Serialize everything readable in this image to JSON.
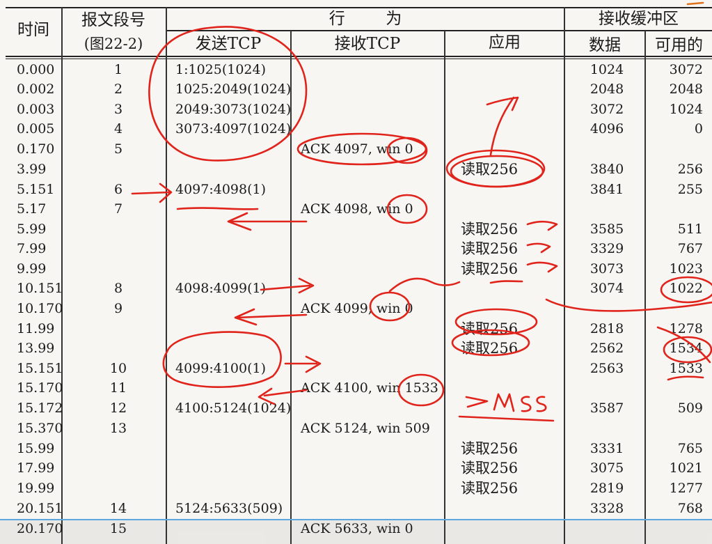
{
  "headers": {
    "time": "时间",
    "segment": "报文段号",
    "segment_sub": "(图22-2)",
    "behavior": "行        为",
    "send_tcp": "发送TCP",
    "recv_tcp": "接收TCP",
    "app": "应用",
    "recv_buffer": "接收缓冲区",
    "data": "数据",
    "available": "可用的"
  },
  "rows": [
    {
      "time": "0.000",
      "seg": "1",
      "send": "1:1025(1024)",
      "recv": "",
      "app": "",
      "data": "1024",
      "avail": "3072"
    },
    {
      "time": "0.002",
      "seg": "2",
      "send": "1025:2049(1024)",
      "recv": "",
      "app": "",
      "data": "2048",
      "avail": "2048"
    },
    {
      "time": "0.003",
      "seg": "3",
      "send": "2049:3073(1024)",
      "recv": "",
      "app": "",
      "data": "3072",
      "avail": "1024"
    },
    {
      "time": "0.005",
      "seg": "4",
      "send": "3073:4097(1024)",
      "recv": "",
      "app": "",
      "data": "4096",
      "avail": "0"
    },
    {
      "time": "0.170",
      "seg": "5",
      "send": "",
      "recv": "ACK 4097, win 0",
      "app": "",
      "data": "",
      "avail": ""
    },
    {
      "time": "3.99",
      "seg": "",
      "send": "",
      "recv": "",
      "app": "读取256",
      "data": "3840",
      "avail": "256"
    },
    {
      "time": "5.151",
      "seg": "6",
      "send": "4097:4098(1)",
      "recv": "",
      "app": "",
      "data": "3841",
      "avail": "255"
    },
    {
      "time": "5.17",
      "seg": "7",
      "send": "",
      "recv": "ACK 4098, win 0",
      "app": "",
      "data": "",
      "avail": ""
    },
    {
      "time": "5.99",
      "seg": "",
      "send": "",
      "recv": "",
      "app": "读取256",
      "data": "3585",
      "avail": "511"
    },
    {
      "time": "7.99",
      "seg": "",
      "send": "",
      "recv": "",
      "app": "读取256",
      "data": "3329",
      "avail": "767"
    },
    {
      "time": "9.99",
      "seg": "",
      "send": "",
      "recv": "",
      "app": "读取256",
      "data": "3073",
      "avail": "1023"
    },
    {
      "time": "10.151",
      "seg": "8",
      "send": "4098:4099(1)",
      "recv": "",
      "app": "",
      "data": "3074",
      "avail": "1022"
    },
    {
      "time": "10.170",
      "seg": "9",
      "send": "",
      "recv": "ACK 4099, win 0",
      "app": "",
      "data": "",
      "avail": ""
    },
    {
      "time": "11.99",
      "seg": "",
      "send": "",
      "recv": "",
      "app": "读取256",
      "data": "2818",
      "avail": "1278"
    },
    {
      "time": "13.99",
      "seg": "",
      "send": "",
      "recv": "",
      "app": "读取256",
      "data": "2562",
      "avail": "1534"
    },
    {
      "time": "15.151",
      "seg": "10",
      "send": "4099:4100(1)",
      "recv": "",
      "app": "",
      "data": "2563",
      "avail": "1533"
    },
    {
      "time": "15.170",
      "seg": "11",
      "send": "",
      "recv": "ACK 4100, win 1533",
      "app": "",
      "data": "",
      "avail": ""
    },
    {
      "time": "15.172",
      "seg": "12",
      "send": "4100:5124(1024)",
      "recv": "",
      "app": "",
      "data": "3587",
      "avail": "509"
    },
    {
      "time": "15.370",
      "seg": "13",
      "send": "",
      "recv": "ACK 5124, win 509",
      "app": "",
      "data": "",
      "avail": ""
    },
    {
      "time": "15.99",
      "seg": "",
      "send": "",
      "recv": "",
      "app": "读取256",
      "data": "3331",
      "avail": "765"
    },
    {
      "time": "17.99",
      "seg": "",
      "send": "",
      "recv": "",
      "app": "读取256",
      "data": "3075",
      "avail": "1021"
    },
    {
      "time": "19.99",
      "seg": "",
      "send": "",
      "recv": "",
      "app": "读取256",
      "data": "2819",
      "avail": "1277"
    },
    {
      "time": "20.151",
      "seg": "14",
      "send": "5124:5633(509)",
      "recv": "",
      "app": "",
      "data": "3328",
      "avail": "768"
    },
    {
      "time": "20.170",
      "seg": "15",
      "send": "",
      "recv": "ACK 5633, win 0",
      "app": "",
      "data": "",
      "avail": ""
    }
  ],
  "annotation": ">MSS",
  "ink_color": "#e0231b"
}
